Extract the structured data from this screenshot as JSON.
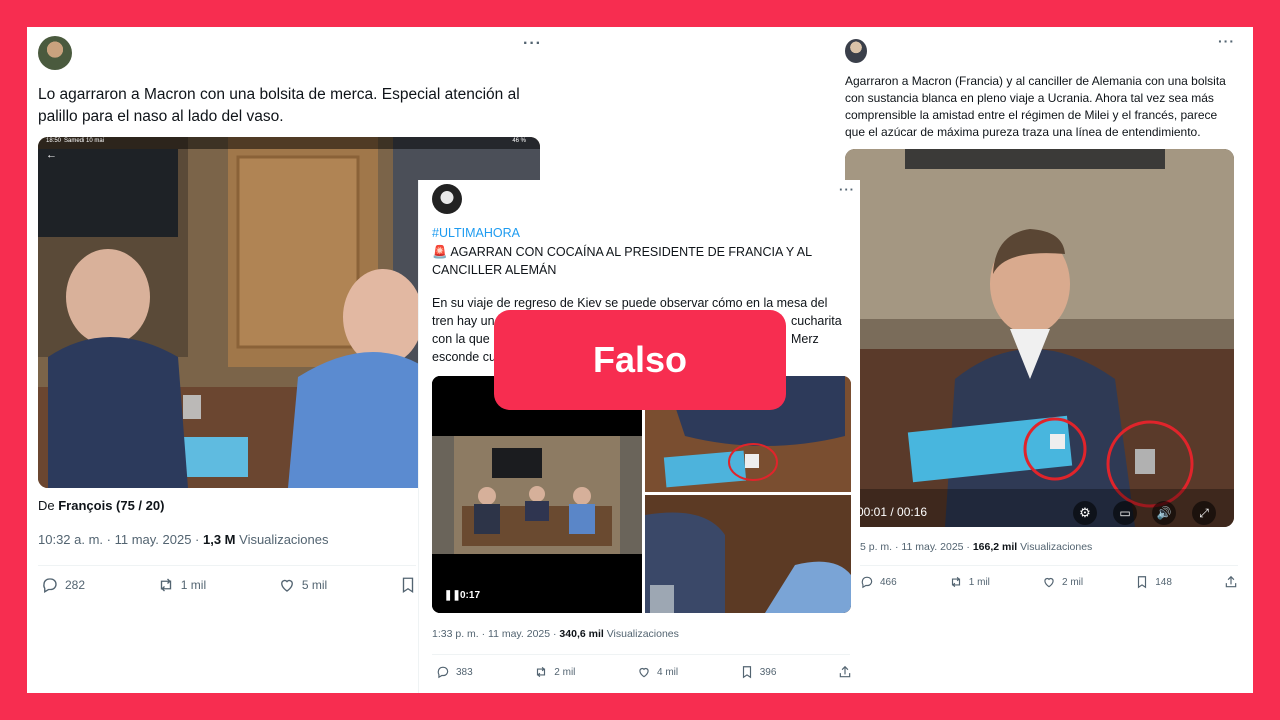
{
  "post1": {
    "text": "Lo agarraron a Macron con una bolsita de merca. Especial atención al palillo para el naso al lado del vaso.",
    "status_time": "18:50",
    "status_date": "Samedi 10 mai",
    "status_battery": "46 %",
    "credit_prefix": "De ",
    "credit_name": "François (75 / 20)",
    "time": "10:32 a. m. · 11 may. 2025 · ",
    "views_count": "1,3 M",
    "views_label": " Visualizaciones",
    "replies": "282",
    "reposts": "1 mil",
    "likes": "5 mil"
  },
  "post2": {
    "hashtag": "#ULTIMAHORA",
    "headline": "🚨 AGARRAN CON COCAÍNA AL PRESIDENTE DE FRANCIA Y AL CANCILLER ALEMÁN",
    "body_l1_a": "En su viaje de regreso de Kiev se puede observar cómo en la mesa del",
    "body_l2_a": "tren hay un",
    "body_l2_b": "cucharita",
    "body_l3_a": "con la que",
    "body_l3_b": "Merz",
    "body_l4_a": "esconde cu",
    "video_time": "0:17",
    "time": "1:33 p. m. · 11 may. 2025 · ",
    "views_count": "340,6 mil",
    "views_label": " Visualizaciones",
    "replies": "383",
    "reposts": "2 mil",
    "likes": "4 mil",
    "bookmarks": "396"
  },
  "post3": {
    "text": "Agarraron a Macron (Francia) y al canciller de Alemania con una bolsita con sustancia blanca en pleno viaje a Ucrania. Ahora tal vez sea más comprensible la amistad entre el régimen de Milei y el francés, parece que el azúcar de máxima pureza traza una línea de entendimiento.",
    "video_progress": "00:01 / 00:16",
    "time": "5 p. m. · 11 may. 2025 · ",
    "views_count": "166,2 mil",
    "views_label": " Visualizaciones",
    "replies": "466",
    "reposts": "1 mil",
    "likes": "2 mil",
    "bookmarks": "148"
  },
  "label": {
    "verdict": "Falso"
  },
  "colors": {
    "brand": "#f72d50",
    "link": "#1d9bf0",
    "muted": "#536471"
  }
}
